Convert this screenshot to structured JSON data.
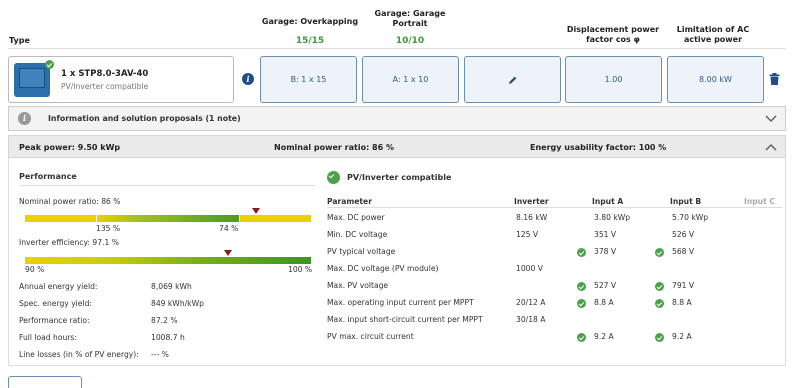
{
  "header": {
    "type_label": "Type",
    "col1_label": "Garage: Overkapping",
    "col1_value": "15/15",
    "col2_label_line1": "Garage: Garage",
    "col2_label_line2": "Portrait",
    "col2_value": "10/10",
    "col3_label": "Displacement power factor cos φ",
    "col4_label": "Limitation of AC active power"
  },
  "inverter": {
    "name": "1 x STP8.0-3AV-40",
    "status": "PV/Inverter compatible",
    "cell_b": "B: 1 x 15",
    "cell_a": "A: 1 x 10",
    "cos_phi": "1.00",
    "ac_limit": "8.00 kW"
  },
  "info_bar": {
    "label": "Information and solution proposals (1 note)"
  },
  "summary": {
    "peak": "Peak power: 9.50 kWp",
    "ratio": "Nominal power ratio: 86 %",
    "usability": "Energy usability factor: 100 %"
  },
  "performance": {
    "title": "Performance",
    "npr_label": "Nominal power ratio: 86 %",
    "npr_tick_low": "135 %",
    "npr_tick_high": "74 %",
    "npr_marker": 0.81,
    "eff_label": "Inverter efficiency: 97.1 %",
    "eff_tick_low": "90 %",
    "eff_tick_high": "100 %",
    "eff_marker": 0.71,
    "rows": [
      {
        "label": "Annual energy yield:",
        "value": "8,069 kWh"
      },
      {
        "label": "Spec. energy yield:",
        "value": "849 kWh/kWp"
      },
      {
        "label": "Performance ratio:",
        "value": "87.2 %"
      },
      {
        "label": "Full load hours:",
        "value": "1008.7 h"
      },
      {
        "label": "Line losses (in % of PV energy):",
        "value": "--- %"
      }
    ]
  },
  "compat": {
    "title": "PV/Inverter compatible",
    "headers": [
      "Parameter",
      "Inverter",
      "Input A",
      "Input B",
      "Input C"
    ],
    "rows": [
      {
        "param": "Max. DC power",
        "inv": "8.16 kW",
        "a": "3.80 kWp",
        "b": "5.70 kWp",
        "ok": false
      },
      {
        "param": "Min. DC voltage",
        "inv": "125 V",
        "a": "351 V",
        "b": "526 V",
        "ok": false
      },
      {
        "param": "PV typical voltage",
        "inv": "",
        "a": "378 V",
        "b": "568 V",
        "ok": true
      },
      {
        "param": "Max. DC voltage (PV module)",
        "inv": "1000 V",
        "a": "",
        "b": "",
        "ok": false
      },
      {
        "param": "Max. PV voltage",
        "inv": "",
        "a": "527 V",
        "b": "791 V",
        "ok": true
      },
      {
        "param": "Max. operating input current per MPPT",
        "inv": "20/12 A",
        "a": "8.8 A",
        "b": "8.8 A",
        "ok": true
      },
      {
        "param": "Max. input short-circuit current per MPPT",
        "inv": "30/18 A",
        "a": "",
        "b": "",
        "ok": false
      },
      {
        "param": "PV max. circuit current",
        "inv": "",
        "a": "9.2 A",
        "b": "9.2 A",
        "ok": true
      }
    ]
  },
  "colors": {
    "accent": "#2a5a8a",
    "ok": "#4aa14a",
    "marker": "#8b1a1a"
  }
}
